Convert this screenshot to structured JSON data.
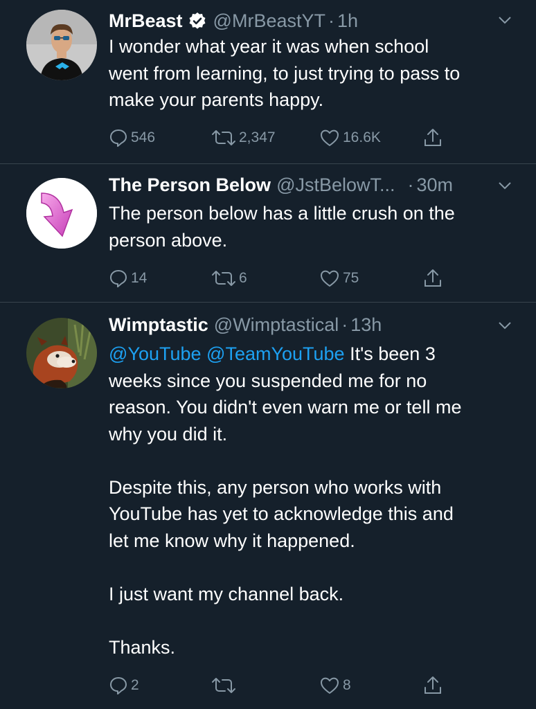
{
  "tweets": [
    {
      "name": "MrBeast",
      "verified": true,
      "handle": "@MrBeastYT",
      "separator": "·",
      "time": "1h",
      "text_lines": [
        "I wonder what year it was when school",
        "went from learning, to just trying to pass to",
        "make your parents happy."
      ],
      "replies": "546",
      "retweets": "2,347",
      "likes": "16.6K"
    },
    {
      "name": "The Person Below",
      "verified": false,
      "handle": "@JstBelowT...",
      "separator": "·",
      "time": "30m",
      "text_lines": [
        "The person below has a little crush on the",
        "person above."
      ],
      "replies": "14",
      "retweets": "6",
      "likes": "75"
    },
    {
      "name": "Wimptastic",
      "verified": false,
      "handle": "@Wimptastical",
      "separator": "·",
      "time": "13h",
      "mention1": "@YouTube",
      "mention2": "@TeamYouTube",
      "text_first_rest": "It's been 3",
      "text_lines": [
        "weeks since you suspended me for no",
        "reason. You didn't even warn me or tell me",
        "why you did it.",
        "Despite this, any person who works with",
        "YouTube has yet to acknowledge this and",
        "let me know why it happened.",
        "I just want my channel back.",
        "Thanks."
      ],
      "replies": "2",
      "retweets": "",
      "likes": "8"
    }
  ],
  "colors": {
    "background": "#15202b",
    "text": "#ffffff",
    "secondary": "#8899a6",
    "link": "#1da1f2",
    "divider": "#38444d"
  }
}
